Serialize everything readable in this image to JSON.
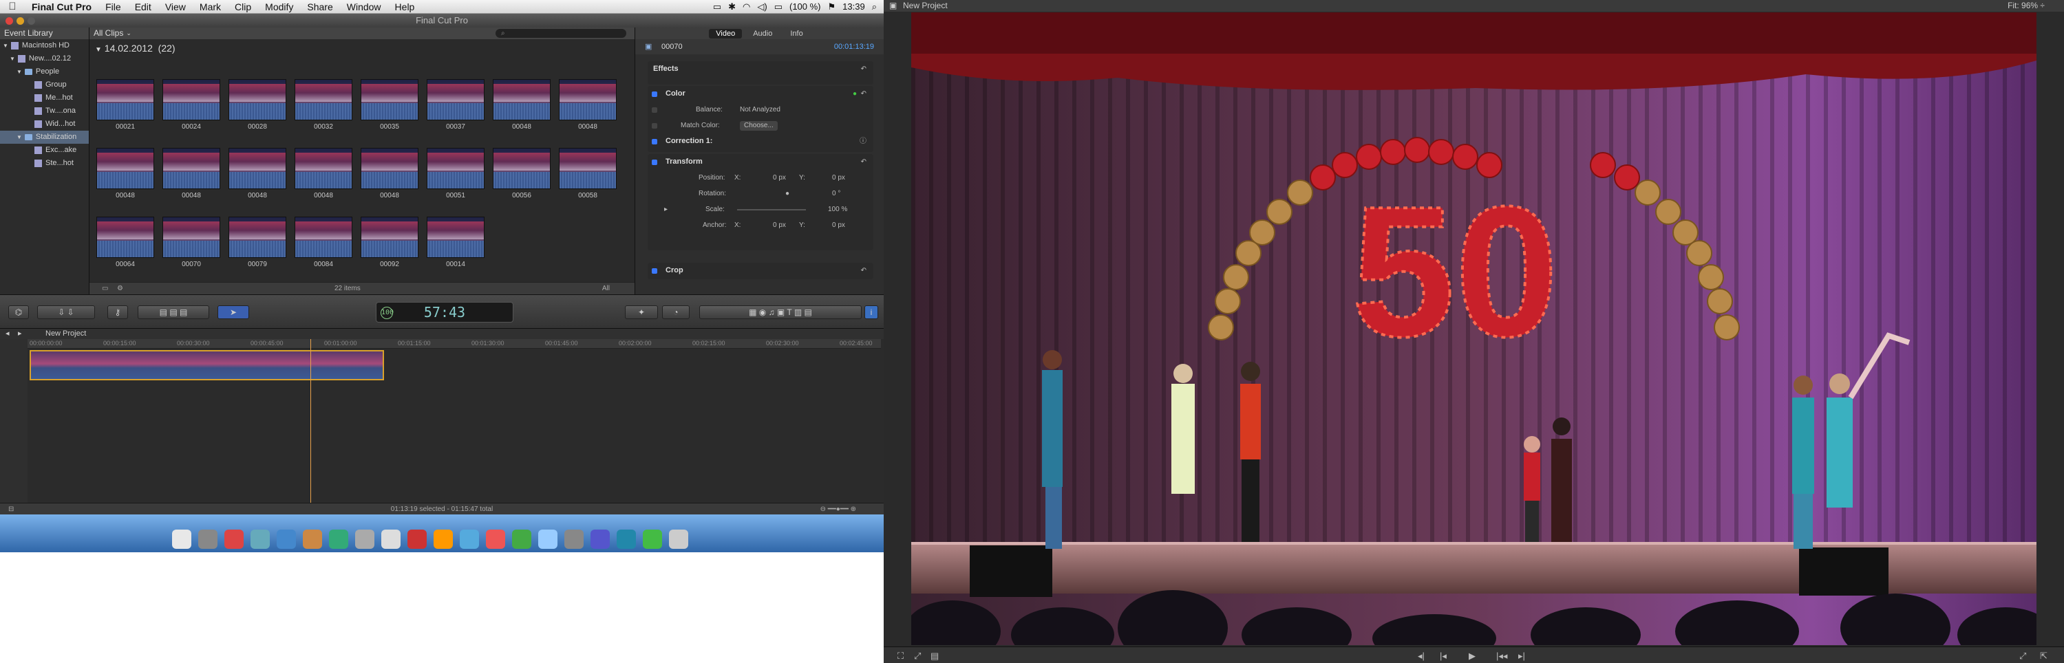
{
  "menubar": {
    "app": "Final Cut Pro",
    "items": [
      "File",
      "Edit",
      "View",
      "Mark",
      "Clip",
      "Modify",
      "Share",
      "Window",
      "Help"
    ],
    "battery": "(100 %)",
    "clock": "13:39"
  },
  "window": {
    "title": "Final Cut Pro"
  },
  "library": {
    "header": "Event Library",
    "items": [
      {
        "label": "Macintosh HD"
      },
      {
        "label": "New....02.12"
      },
      {
        "label": "People"
      },
      {
        "label": "Group"
      },
      {
        "label": "Me...hot"
      },
      {
        "label": "Tw....ona"
      },
      {
        "label": "Wid...hot"
      },
      {
        "label": "Stabilization"
      },
      {
        "label": "Exc...ake"
      },
      {
        "label": "Ste...hot"
      }
    ]
  },
  "browser": {
    "filter": "All Clips",
    "date_group": "14.02.2012",
    "count": "(22)",
    "clips": [
      "00021",
      "00024",
      "00028",
      "00032",
      "00035",
      "00037",
      "00048",
      "00048",
      "00048",
      "00048",
      "00048",
      "00048",
      "00048",
      "00051",
      "00056",
      "00058",
      "00064",
      "00070",
      "00079",
      "00084",
      "00092",
      "00014"
    ],
    "footer_items": "22 items",
    "footer_filter": "All"
  },
  "inspector": {
    "tabs": [
      "Video",
      "Audio",
      "Info"
    ],
    "clip_name": "00070",
    "timecode": "00:01:13:19",
    "effects_label": "Effects",
    "color": {
      "label": "Color",
      "balance_label": "Balance:",
      "balance_value": "Not Analyzed",
      "match_label": "Match Color:",
      "match_button": "Choose...",
      "correction": "Correction 1:"
    },
    "transform": {
      "label": "Transform",
      "position": "Position:",
      "x": "X:",
      "x_value": "0 px",
      "y": "Y:",
      "y_value": "0 px",
      "rotation": "Rotation:",
      "rotation_value": "0 °",
      "scale": "Scale:",
      "scale_value": "100 %",
      "anchor": "Anchor:",
      "ax": "X:",
      "ax_value": "0 px",
      "ay": "Y:",
      "ay_value": "0 px"
    },
    "crop": "Crop"
  },
  "toolbar": {
    "timecode": "57:43",
    "percent": "100"
  },
  "timeline": {
    "project": "New Project",
    "ruler": [
      "00:00:00:00",
      "00:00:15:00",
      "00:00:30:00",
      "00:00:45:00",
      "00:01:00:00",
      "00:01:15:00",
      "00:01:30:00",
      "00:01:45:00",
      "00:02:00:00",
      "00:02:15:00",
      "00:02:30:00",
      "00:02:45:00"
    ],
    "status": "01:13:19 selected - 01:15:47 total"
  },
  "viewer": {
    "title": "New Project",
    "fit": "Fit:  96% ÷"
  },
  "colors": {
    "accent": "#3a78ff",
    "clip_border": "#d9a12b",
    "playhead": "#e8a24c"
  }
}
